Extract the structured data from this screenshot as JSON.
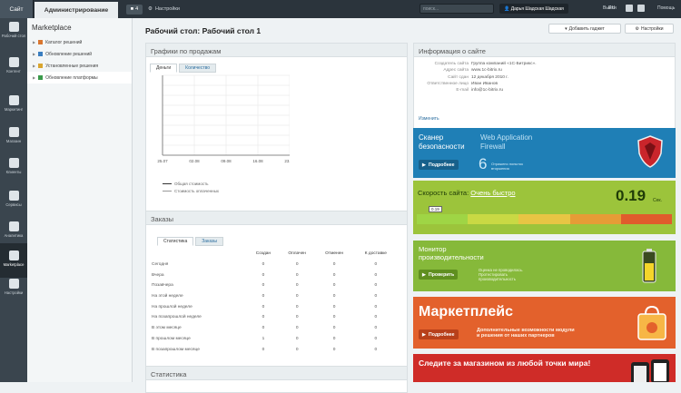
{
  "top": {
    "site": "Сайт",
    "admin": "Администрирование",
    "notif_count": "4",
    "settings": "Настройки",
    "search_placeholder": "поиск...",
    "user": "Дарья Шадская Шадская",
    "logout": "Выйти",
    "lang": "RU",
    "help": "Помощь"
  },
  "sidebar": [
    {
      "label": "Рабочий стол"
    },
    {
      "label": "Контент"
    },
    {
      "label": "Маркетинг"
    },
    {
      "label": "Магазин"
    },
    {
      "label": "Клиенты"
    },
    {
      "label": "Сервисы"
    },
    {
      "label": "Аналитика"
    },
    {
      "label": "Marketplace"
    },
    {
      "label": "Настройки"
    }
  ],
  "panel": {
    "title": "Marketplace",
    "items": [
      {
        "label": "Каталог решений",
        "color": "#d9762f"
      },
      {
        "label": "Обновление решений",
        "color": "#3a7ec0"
      },
      {
        "label": "Установленные решения",
        "color": "#d9a52f"
      },
      {
        "label": "Обновление платформы",
        "color": "#3a9a4a"
      }
    ]
  },
  "page": {
    "title": "Рабочий стол: Рабочий стол 1",
    "add_gadget": "Добавить гаджет",
    "settings": "Настройки"
  },
  "sales": {
    "title": "Графики по продажам",
    "tabs": [
      "Деньги",
      "Количество"
    ],
    "legend": [
      "Общая стоимость",
      "Стоимость оплаченных"
    ]
  },
  "chart_data": {
    "type": "line",
    "x": [
      "25.07",
      "02.08",
      "09.08",
      "16.08",
      "23.08"
    ],
    "series": [
      {
        "name": "Общая стоимость",
        "values": [
          0,
          0,
          0,
          0,
          0
        ]
      },
      {
        "name": "Стоимость оплаченных",
        "values": [
          0,
          0,
          0,
          0,
          0
        ]
      }
    ],
    "grid": true
  },
  "orders": {
    "title": "Заказы",
    "tabs": [
      "Статистика",
      "Заказы"
    ],
    "columns": [
      "Создан",
      "Оплачен",
      "Отменен",
      "К доставке"
    ],
    "rows": [
      {
        "label": "Сегодня",
        "v": [
          "0",
          "0",
          "0",
          "0"
        ]
      },
      {
        "label": "Вчера",
        "v": [
          "0",
          "0",
          "0",
          "0"
        ]
      },
      {
        "label": "Позавчера",
        "v": [
          "0",
          "0",
          "0",
          "0"
        ]
      },
      {
        "label": "На этой неделе",
        "v": [
          "0",
          "0",
          "0",
          "0"
        ]
      },
      {
        "label": "На прошлой неделе",
        "v": [
          "0",
          "0",
          "0",
          "0"
        ]
      },
      {
        "label": "На позапрошлой неделе",
        "v": [
          "0",
          "0",
          "0",
          "0"
        ]
      },
      {
        "label": "В этом месяце",
        "v": [
          "0",
          "0",
          "0",
          "0"
        ]
      },
      {
        "label": "В прошлом месяце",
        "v": [
          "1",
          "0",
          "0",
          "0"
        ]
      },
      {
        "label": "В позапрошлом месяце",
        "v": [
          "0",
          "0",
          "0",
          "0"
        ]
      }
    ]
  },
  "stats": {
    "title": "Статистика"
  },
  "info": {
    "title": "Информация о сайте",
    "rows": [
      {
        "label": "Создатель сайта",
        "value": "Группа компаний «1С-Битрикс»."
      },
      {
        "label": "Адрес сайта",
        "value": "www.1c-bitrix.ru"
      },
      {
        "label": "Сайт сдан",
        "value": "12 декабря 2010 г."
      },
      {
        "label": "Ответственное лицо",
        "value": "Иван Иванов"
      },
      {
        "label": "E-mail",
        "value": "info@1c-bitrix.ru"
      }
    ],
    "edit": "Изменить"
  },
  "scanner": {
    "title": "Сканер безопасности",
    "waf": "Web Application Firewall",
    "button": "Подробнее",
    "count": "6",
    "count_text": "Отражено попыток вторжения"
  },
  "speed": {
    "title": "Скорость сайта:",
    "status": "Очень быстро",
    "value": "0.19",
    "unit": "Сек.",
    "marker": "0.19"
  },
  "monitor": {
    "title": "Монитор производительности",
    "button": "Проверить",
    "desc": "Оценка не проводилась. Протестировать производительность"
  },
  "market": {
    "title": "Маркетплейс",
    "button": "Подробнее",
    "desc": "Дополнительные возможности модули и решения от наших партнеров"
  },
  "shop": {
    "title": "Следите за магазином из любой точки мира!"
  },
  "colors": {
    "topbar": "#2b343c",
    "scanner": "#1f7fb6",
    "speed": "#9cc43b",
    "monitor": "#86b93a",
    "market": "#e3612c",
    "shop": "#cf2c28"
  }
}
